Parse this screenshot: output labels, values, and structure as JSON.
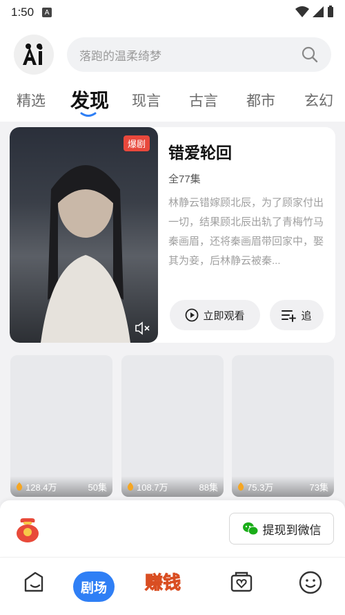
{
  "status": {
    "time": "1:50",
    "a_badge": "A"
  },
  "search": {
    "placeholder": "落跑的温柔绮梦"
  },
  "tabs": [
    "精选",
    "发现",
    "现言",
    "古言",
    "都市",
    "玄幻"
  ],
  "active_tab": "发现",
  "feature": {
    "badge": "爆剧",
    "title": "错爱轮回",
    "episodes": "全77集",
    "description": "林静云错嫁顾北辰，为了顾家付出一切，结果顾北辰出轨了青梅竹马秦画眉，还将秦画眉带回家中，娶其为妾，后林静云被秦...",
    "watch_label": "立即观看",
    "follow_label": "追"
  },
  "grid": [
    {
      "views": "128.4万",
      "episodes": "50集"
    },
    {
      "views": "108.7万",
      "episodes": "88集"
    },
    {
      "views": "75.3万",
      "episodes": "73集"
    }
  ],
  "reward": {
    "wechat_label": "提现到微信"
  },
  "nav": {
    "theater_label": "剧场",
    "earn_label": "赚钱"
  },
  "colors": {
    "accent": "#2f7ff5",
    "badge": "#e8483c",
    "wechat": "#1aad19",
    "earn": "#f59a1c"
  }
}
